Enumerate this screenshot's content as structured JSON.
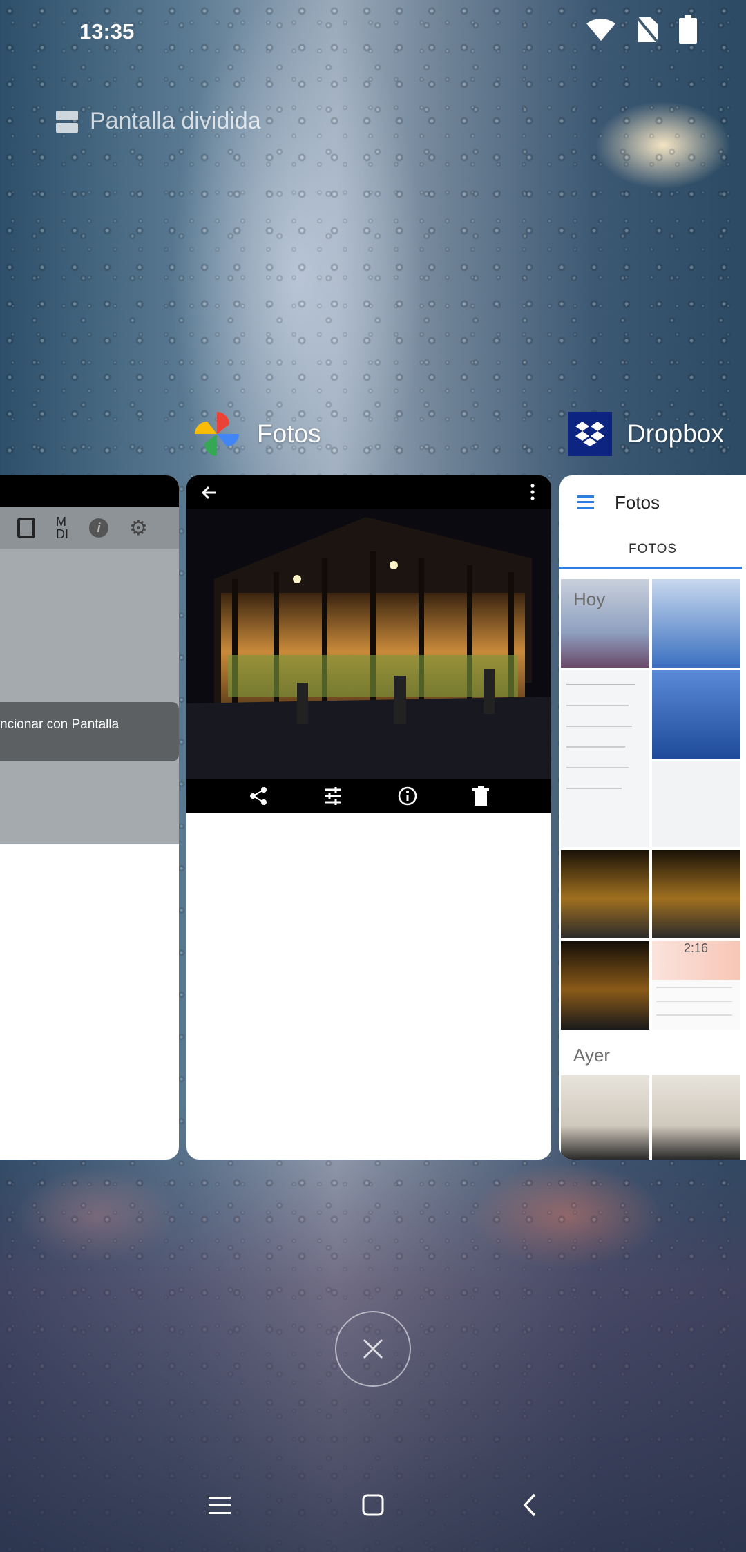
{
  "status_bar": {
    "time": "13:35",
    "icons": [
      "wifi-icon",
      "no-sim-icon",
      "battery-icon"
    ]
  },
  "split_screen": {
    "icon": "split-screen-icon",
    "label": "Pantalla dividida"
  },
  "apps": [
    {
      "name": "Fotos",
      "icon": "google-photos-icon"
    },
    {
      "name": "Dropbox",
      "icon": "dropbox-icon"
    }
  ],
  "left_card": {
    "toolbar_text": "M\nDI",
    "toast_text": "ncionar con Pantalla"
  },
  "center_card": {
    "top_actions": [
      "back-arrow-icon",
      "more-vert-icon"
    ],
    "bottom_actions": [
      "share-icon",
      "edit-sliders-icon",
      "info-icon",
      "delete-icon"
    ]
  },
  "right_card": {
    "title": "Fotos",
    "tab": "FOTOS",
    "sections": [
      "Hoy",
      "Ayer"
    ],
    "clock_text": "2:16"
  },
  "navigation": {
    "buttons": [
      "menu-icon",
      "home-icon",
      "back-icon"
    ]
  },
  "colors": {
    "accent_blue": "#2f7de1",
    "dropbox_blue": "#0d2481"
  }
}
